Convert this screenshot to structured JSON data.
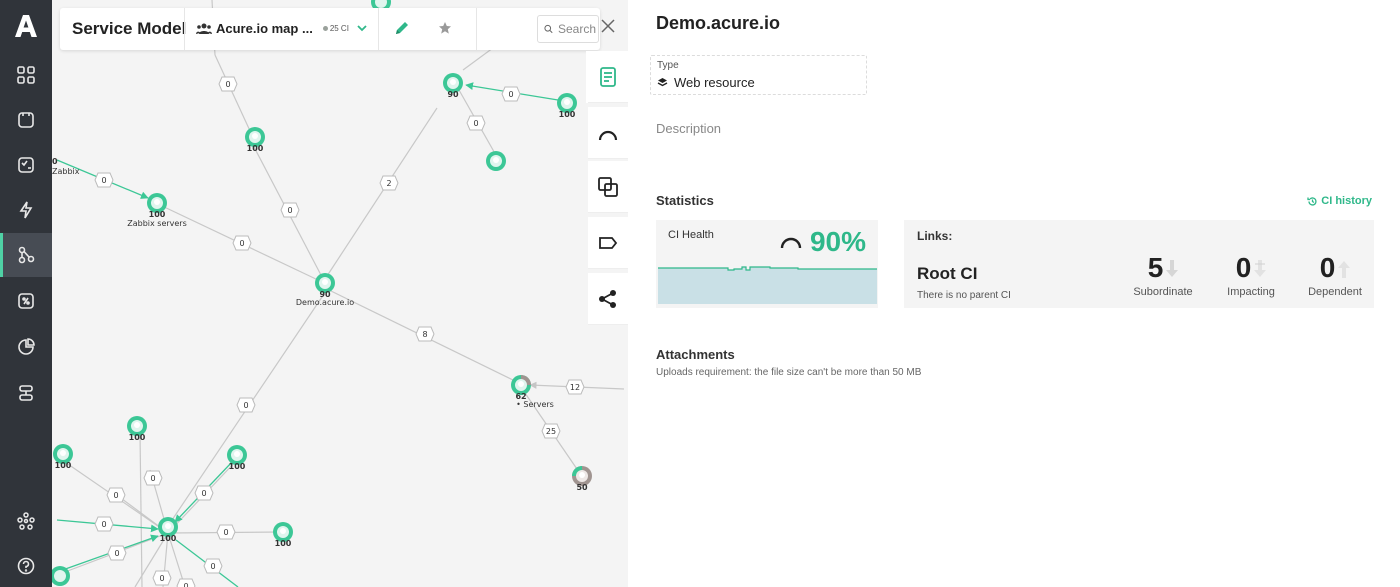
{
  "toolbar": {
    "title": "Service Model",
    "map_name": "Acure.io map ...",
    "ci_count": "25 CI",
    "search_placeholder": "Search"
  },
  "graph": {
    "nodes": [
      {
        "id": "n-top",
        "label": "90"
      },
      {
        "id": "n-top-right",
        "label": "100"
      },
      {
        "id": "n-top-mid",
        "label": ""
      },
      {
        "id": "n-a",
        "label": "100"
      },
      {
        "id": "n-zabbix",
        "label": "100",
        "name": "Zabbix servers"
      },
      {
        "id": "n-zabbix-left",
        "label": "0",
        "name": "Zabbix"
      },
      {
        "id": "n-center",
        "label": "90",
        "name": "Demo.acure.io"
      },
      {
        "id": "n-servers",
        "label": "62",
        "name": "• Servers"
      },
      {
        "id": "n-50",
        "label": "50"
      },
      {
        "id": "n-left1",
        "label": "100"
      },
      {
        "id": "n-left2",
        "label": "100"
      },
      {
        "id": "n-mid100",
        "label": "100"
      },
      {
        "id": "n-hub",
        "label": "100"
      },
      {
        "id": "n-right100",
        "label": "100"
      },
      {
        "id": "n-bottom-left",
        "label": ""
      }
    ],
    "edge_labels": [
      "0",
      "0",
      "0",
      "0",
      "2",
      "0",
      "0",
      "0",
      "8",
      "12",
      "25",
      "0",
      "0",
      "0",
      "0",
      "0",
      "0",
      "0",
      "0",
      "0"
    ]
  },
  "side_tabs": [
    {
      "name": "info",
      "icon": "document-icon"
    },
    {
      "name": "health",
      "icon": "gauge-icon"
    },
    {
      "name": "relations",
      "icon": "copy-icon"
    },
    {
      "name": "tags",
      "icon": "tag-icon"
    },
    {
      "name": "share",
      "icon": "share-icon"
    }
  ],
  "panel": {
    "title": "Demo.acure.io",
    "type_label": "Type",
    "type_value": "Web resource",
    "description_label": "Description",
    "statistics_label": "Statistics",
    "history_link": "CI history",
    "health": {
      "label": "CI Health",
      "value": "90%",
      "value_fraction": 0.9
    },
    "links": {
      "title": "Links:",
      "root_title": "Root CI",
      "root_sub": "There is no parent CI",
      "subordinate": {
        "value": "5",
        "label": "Subordinate"
      },
      "impacting": {
        "value": "0",
        "label": "Impacting"
      },
      "dependent": {
        "value": "0",
        "label": "Dependent"
      }
    },
    "attachments_label": "Attachments",
    "attachments_sub": "Uploads requirement: the file size can't be more than 50 MB"
  },
  "colors": {
    "accent": "#2fb88a",
    "nav_bg": "#30343a",
    "health_ok": "#3cc796",
    "health_warn": "#a09490"
  }
}
